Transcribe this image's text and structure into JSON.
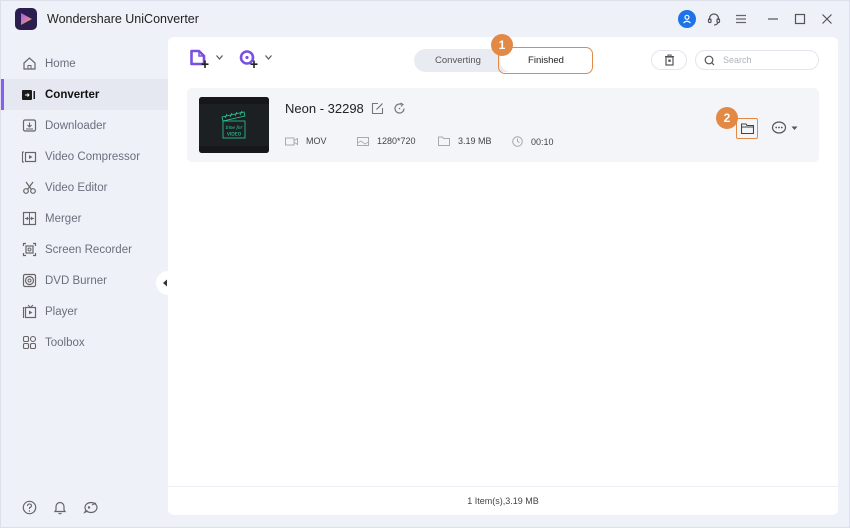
{
  "app": {
    "title": "Wondershare UniConverter"
  },
  "titlebar": {
    "icons": [
      "user-avatar-icon",
      "support-headset-icon",
      "menu-icon",
      "minimize-icon",
      "maximize-icon",
      "close-icon"
    ]
  },
  "sidebar": {
    "items": [
      {
        "label": "Home",
        "icon": "home-icon",
        "active": false
      },
      {
        "label": "Converter",
        "icon": "converter-icon",
        "active": true
      },
      {
        "label": "Downloader",
        "icon": "downloader-icon",
        "active": false
      },
      {
        "label": "Video Compressor",
        "icon": "video-compressor-icon",
        "active": false
      },
      {
        "label": "Video Editor",
        "icon": "video-editor-icon",
        "active": false
      },
      {
        "label": "Merger",
        "icon": "merger-icon",
        "active": false
      },
      {
        "label": "Screen Recorder",
        "icon": "screen-recorder-icon",
        "active": false
      },
      {
        "label": "DVD Burner",
        "icon": "dvd-burner-icon",
        "active": false
      },
      {
        "label": "Player",
        "icon": "player-icon",
        "active": false
      },
      {
        "label": "Toolbox",
        "icon": "toolbox-icon",
        "active": false
      }
    ],
    "bottom_icons": [
      "help-icon",
      "notification-bell-icon",
      "feedback-icon"
    ]
  },
  "toolbar": {
    "add_file_icon": "add-file-icon",
    "add_disc_icon": "add-disc-icon",
    "tabs": [
      {
        "label": "Converting",
        "active": false
      },
      {
        "label": "Finished",
        "active": true
      }
    ],
    "search_placeholder": "Search",
    "search_value": "",
    "callouts": [
      "1",
      "2"
    ]
  },
  "files": [
    {
      "name": "Neon - 32298",
      "format": "MOV",
      "resolution": "1280*720",
      "size": "3.19 MB",
      "duration": "00:10",
      "thumb_text": [
        "time for",
        "VIDEO"
      ]
    }
  ],
  "footer": {
    "summary": "1 Item(s),3.19 MB"
  },
  "colors": {
    "accent": "#8a5cf6",
    "callout": "#e28a45",
    "avatar": "#1e73e8"
  }
}
